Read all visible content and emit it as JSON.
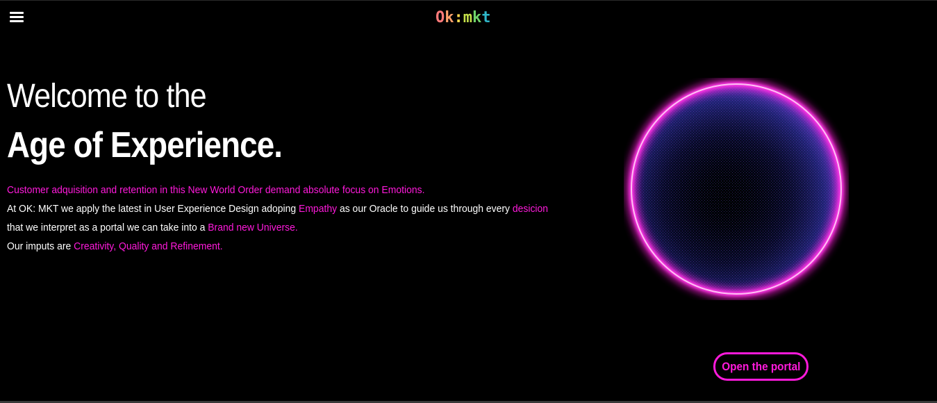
{
  "header": {
    "menu_icon": "hamburger-menu-icon",
    "logo": {
      "parts": [
        {
          "text": "O",
          "color": "#ff7a7a"
        },
        {
          "text": "k",
          "color": "#ff9f6b"
        },
        {
          "text": ":",
          "color": "#ffd84d"
        },
        {
          "text": "m",
          "color": "#c6e24a"
        },
        {
          "text": "k",
          "color": "#6fd36a"
        },
        {
          "text": "t",
          "color": "#2fb6c9"
        }
      ]
    }
  },
  "hero": {
    "welcome": "Welcome to the",
    "headline": "Age of Experience.",
    "lines": [
      [
        {
          "text": "Customer adquisition and retention in this New World Order demand absolute focus on Emotions.",
          "highlight": true
        }
      ],
      [
        {
          "text": "At OK: MKT we apply the latest in User Experience Design adoping ",
          "highlight": false
        },
        {
          "text": "Empathy",
          "highlight": true
        },
        {
          "text": " as our Oracle to guide us through every ",
          "highlight": false
        },
        {
          "text": "desicion",
          "highlight": true
        }
      ],
      [
        {
          "text": "that we interpret as a portal we can take into a ",
          "highlight": false
        },
        {
          "text": "Brand new Universe.",
          "highlight": true
        }
      ],
      [
        {
          "text": "Our imputs are ",
          "highlight": false
        },
        {
          "text": "Creativity, Quality and Refinement.",
          "highlight": true
        }
      ]
    ]
  },
  "portal": {
    "icon": "portal-ring-graphic",
    "ring_color": "#ff1adb",
    "particle_color": "#5a5cff"
  },
  "cta": {
    "label": "Open the portal"
  },
  "colors": {
    "accent": "#ff1adb",
    "background": "#000000",
    "text": "#ffffff"
  }
}
